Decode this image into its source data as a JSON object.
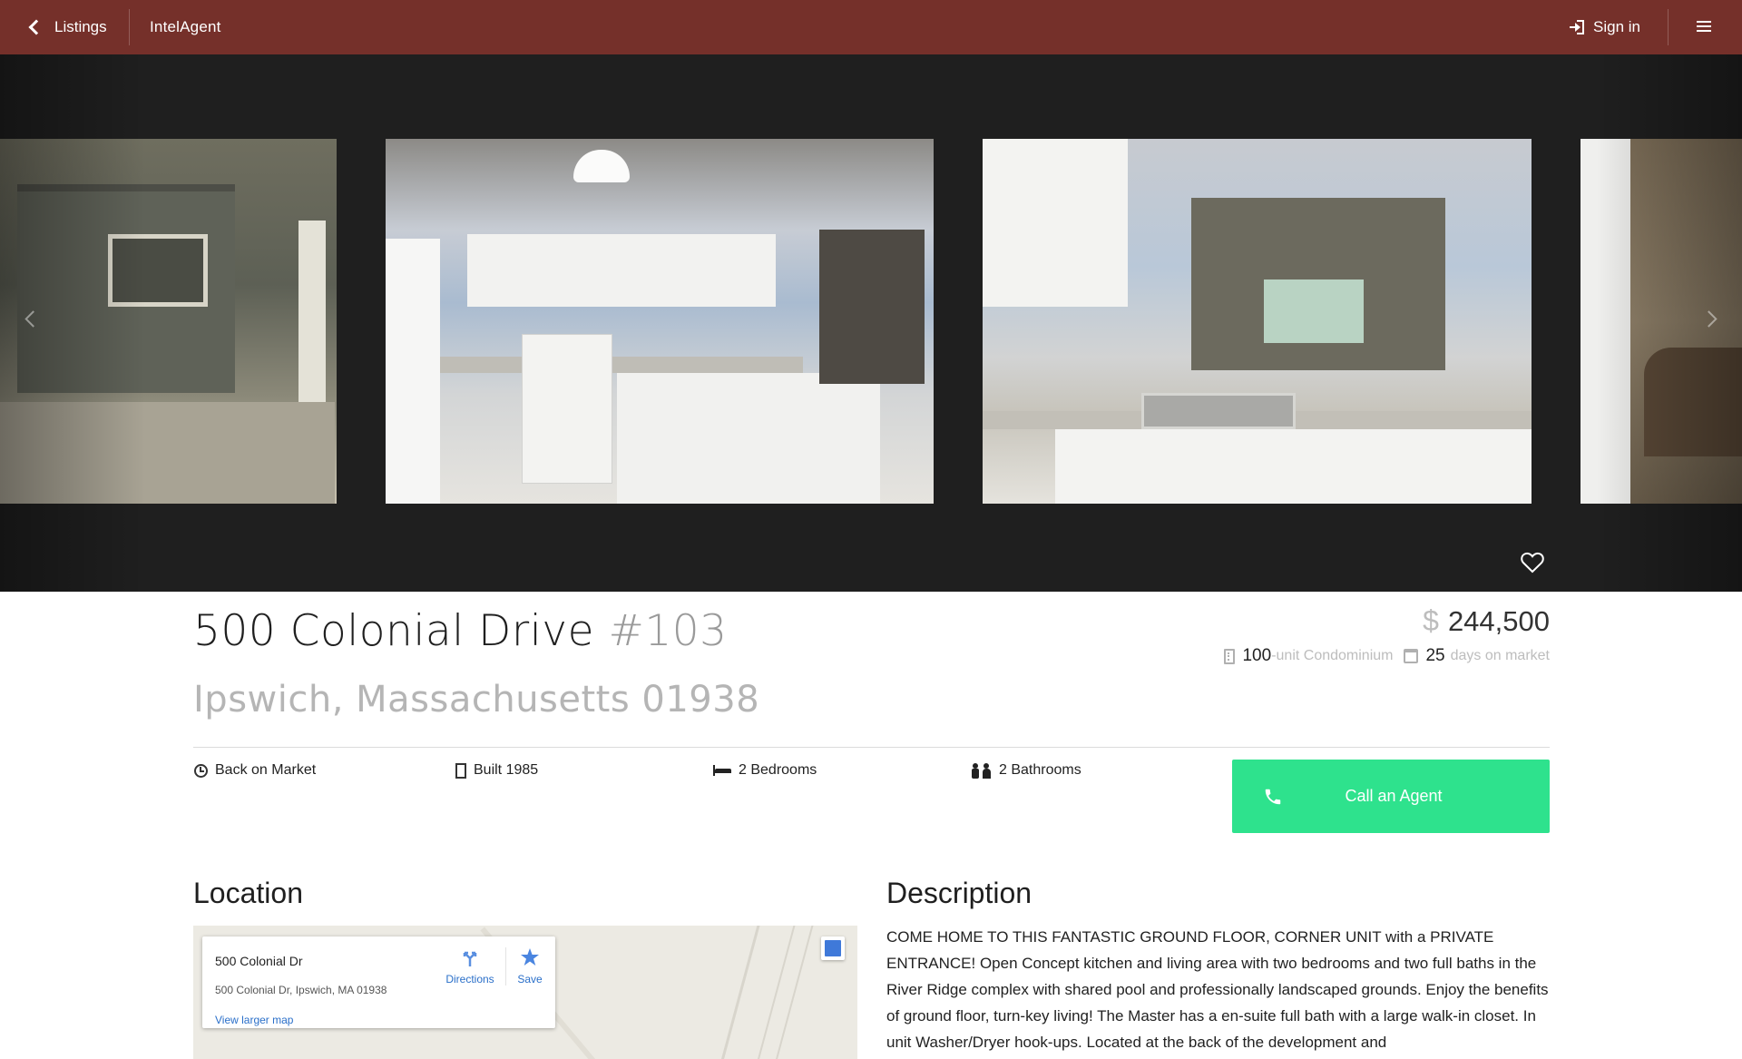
{
  "topbar": {
    "back_label": "Listings",
    "brand": "IntelAgent",
    "signin_label": "Sign in",
    "background": "#75302a"
  },
  "gallery": {
    "photos": [
      "porch-photo",
      "kitchen-photo",
      "kitchen-view-photo",
      "living-room-photo"
    ]
  },
  "listing": {
    "street": "500 Colonial Drive",
    "unit": "#103",
    "city_line": "Ipswich, Massachusetts 01938",
    "currency": "$",
    "price": "244,500",
    "units_num": "100",
    "units_label": "-unit Condominium",
    "days_num": "25",
    "days_label": "days on market"
  },
  "features": {
    "status": "Back on Market",
    "built": "Built 1985",
    "bedrooms": "2 Bedrooms",
    "bathrooms": "2 Bathrooms"
  },
  "call_button": {
    "label": "Call an Agent",
    "color": "#2ee28d"
  },
  "location": {
    "heading": "Location",
    "map_card": {
      "name": "500 Colonial Dr",
      "address": "500 Colonial Dr, Ipswich, MA 01938",
      "directions": "Directions",
      "save": "Save",
      "larger_map": "View larger map"
    }
  },
  "description": {
    "heading": "Description",
    "text": "COME HOME TO THIS FANTASTIC GROUND FLOOR, CORNER UNIT with a PRIVATE ENTRANCE! Open Concept kitchen and living area with two bedrooms and two full baths in the River Ridge complex with shared pool and professionally landscaped grounds. Enjoy the benefits of ground floor, turn-key living! The Master has a en-suite full bath with a large walk-in closet. In unit Washer/Dryer hook-ups. Located at the back of the development and"
  }
}
